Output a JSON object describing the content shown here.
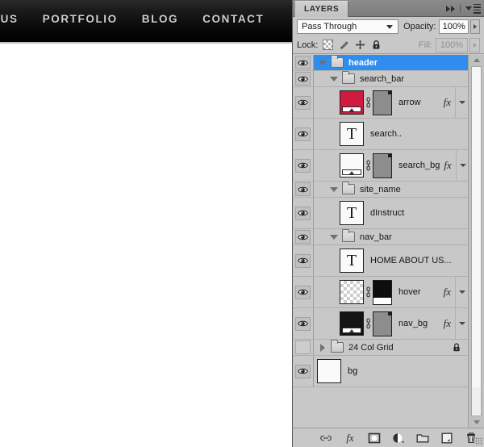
{
  "site": {
    "nav_items": [
      "OUT US",
      "PORTFOLIO",
      "BLOG",
      "CONTACT"
    ]
  },
  "panel": {
    "tab_label": "LAYERS",
    "blend_mode": "Pass Through",
    "opacity_label": "Opacity:",
    "opacity_value": "100%",
    "lock_label": "Lock:",
    "fill_label": "Fill:",
    "fill_value": "100%",
    "lock_icons": [
      "lock-transparent-pixels-icon",
      "lock-image-pixels-icon",
      "lock-position-icon",
      "lock-all-icon"
    ],
    "header_icons": [
      "collapse-to-icons-icon",
      "panel-menu-icon"
    ]
  },
  "layers": [
    {
      "name": "header",
      "type": "group",
      "indent": 0,
      "visible": true,
      "selected": true,
      "expanded": true,
      "fx": false,
      "locked": false
    },
    {
      "name": "search_bar",
      "type": "group",
      "indent": 1,
      "visible": true,
      "selected": false,
      "expanded": true,
      "fx": false,
      "locked": false
    },
    {
      "name": "arrow",
      "type": "layer",
      "indent": 2,
      "visible": true,
      "selected": false,
      "fx": true,
      "thumb": "red",
      "mask": true,
      "linked": true
    },
    {
      "name": "search..",
      "type": "text",
      "indent": 2,
      "visible": true,
      "selected": false,
      "fx": false,
      "thumb": "text",
      "mask": false,
      "linked": false
    },
    {
      "name": "search_bg",
      "type": "layer",
      "indent": 2,
      "visible": true,
      "selected": false,
      "fx": true,
      "thumb": "white",
      "mask": true,
      "linked": true
    },
    {
      "name": "site_name",
      "type": "group",
      "indent": 1,
      "visible": true,
      "selected": false,
      "expanded": true,
      "fx": false,
      "locked": false
    },
    {
      "name": "dInstruct",
      "type": "text",
      "indent": 2,
      "visible": true,
      "selected": false,
      "fx": false,
      "thumb": "text",
      "mask": false,
      "linked": false
    },
    {
      "name": "nav_bar",
      "type": "group",
      "indent": 1,
      "visible": true,
      "selected": false,
      "expanded": true,
      "fx": false,
      "locked": false
    },
    {
      "name": "HOME   ABOUT US...",
      "type": "text",
      "indent": 2,
      "visible": true,
      "selected": false,
      "fx": false,
      "thumb": "text",
      "mask": false,
      "linked": false
    },
    {
      "name": "hover",
      "type": "layer",
      "indent": 2,
      "visible": true,
      "selected": false,
      "fx": true,
      "thumb": "trans",
      "mask": true,
      "maskstyle": "blackwhite",
      "linked": true
    },
    {
      "name": "nav_bg",
      "type": "layer",
      "indent": 2,
      "visible": true,
      "selected": false,
      "fx": true,
      "thumb": "black",
      "mask": true,
      "linked": true
    },
    {
      "name": "24 Col Grid",
      "type": "group",
      "indent": 0,
      "visible": false,
      "selected": false,
      "expanded": false,
      "fx": false,
      "locked": true
    },
    {
      "name": "bg",
      "type": "layer",
      "indent": 0,
      "visible": true,
      "selected": false,
      "fx": false,
      "thumb": "white-plain",
      "mask": false,
      "linked": false
    }
  ],
  "bottom_toolbar": {
    "buttons": [
      "link-layers-icon",
      "add-layer-style-icon",
      "add-layer-mask-icon",
      "new-adjustment-layer-icon",
      "new-group-icon",
      "new-layer-icon",
      "delete-layer-icon"
    ]
  },
  "colors": {
    "panel_bg": "#c8c8c8",
    "selection_blue": "#2e8ded",
    "arrow_thumb_red": "#d11a3f",
    "site_navbar_black": "#0b0b0b"
  }
}
